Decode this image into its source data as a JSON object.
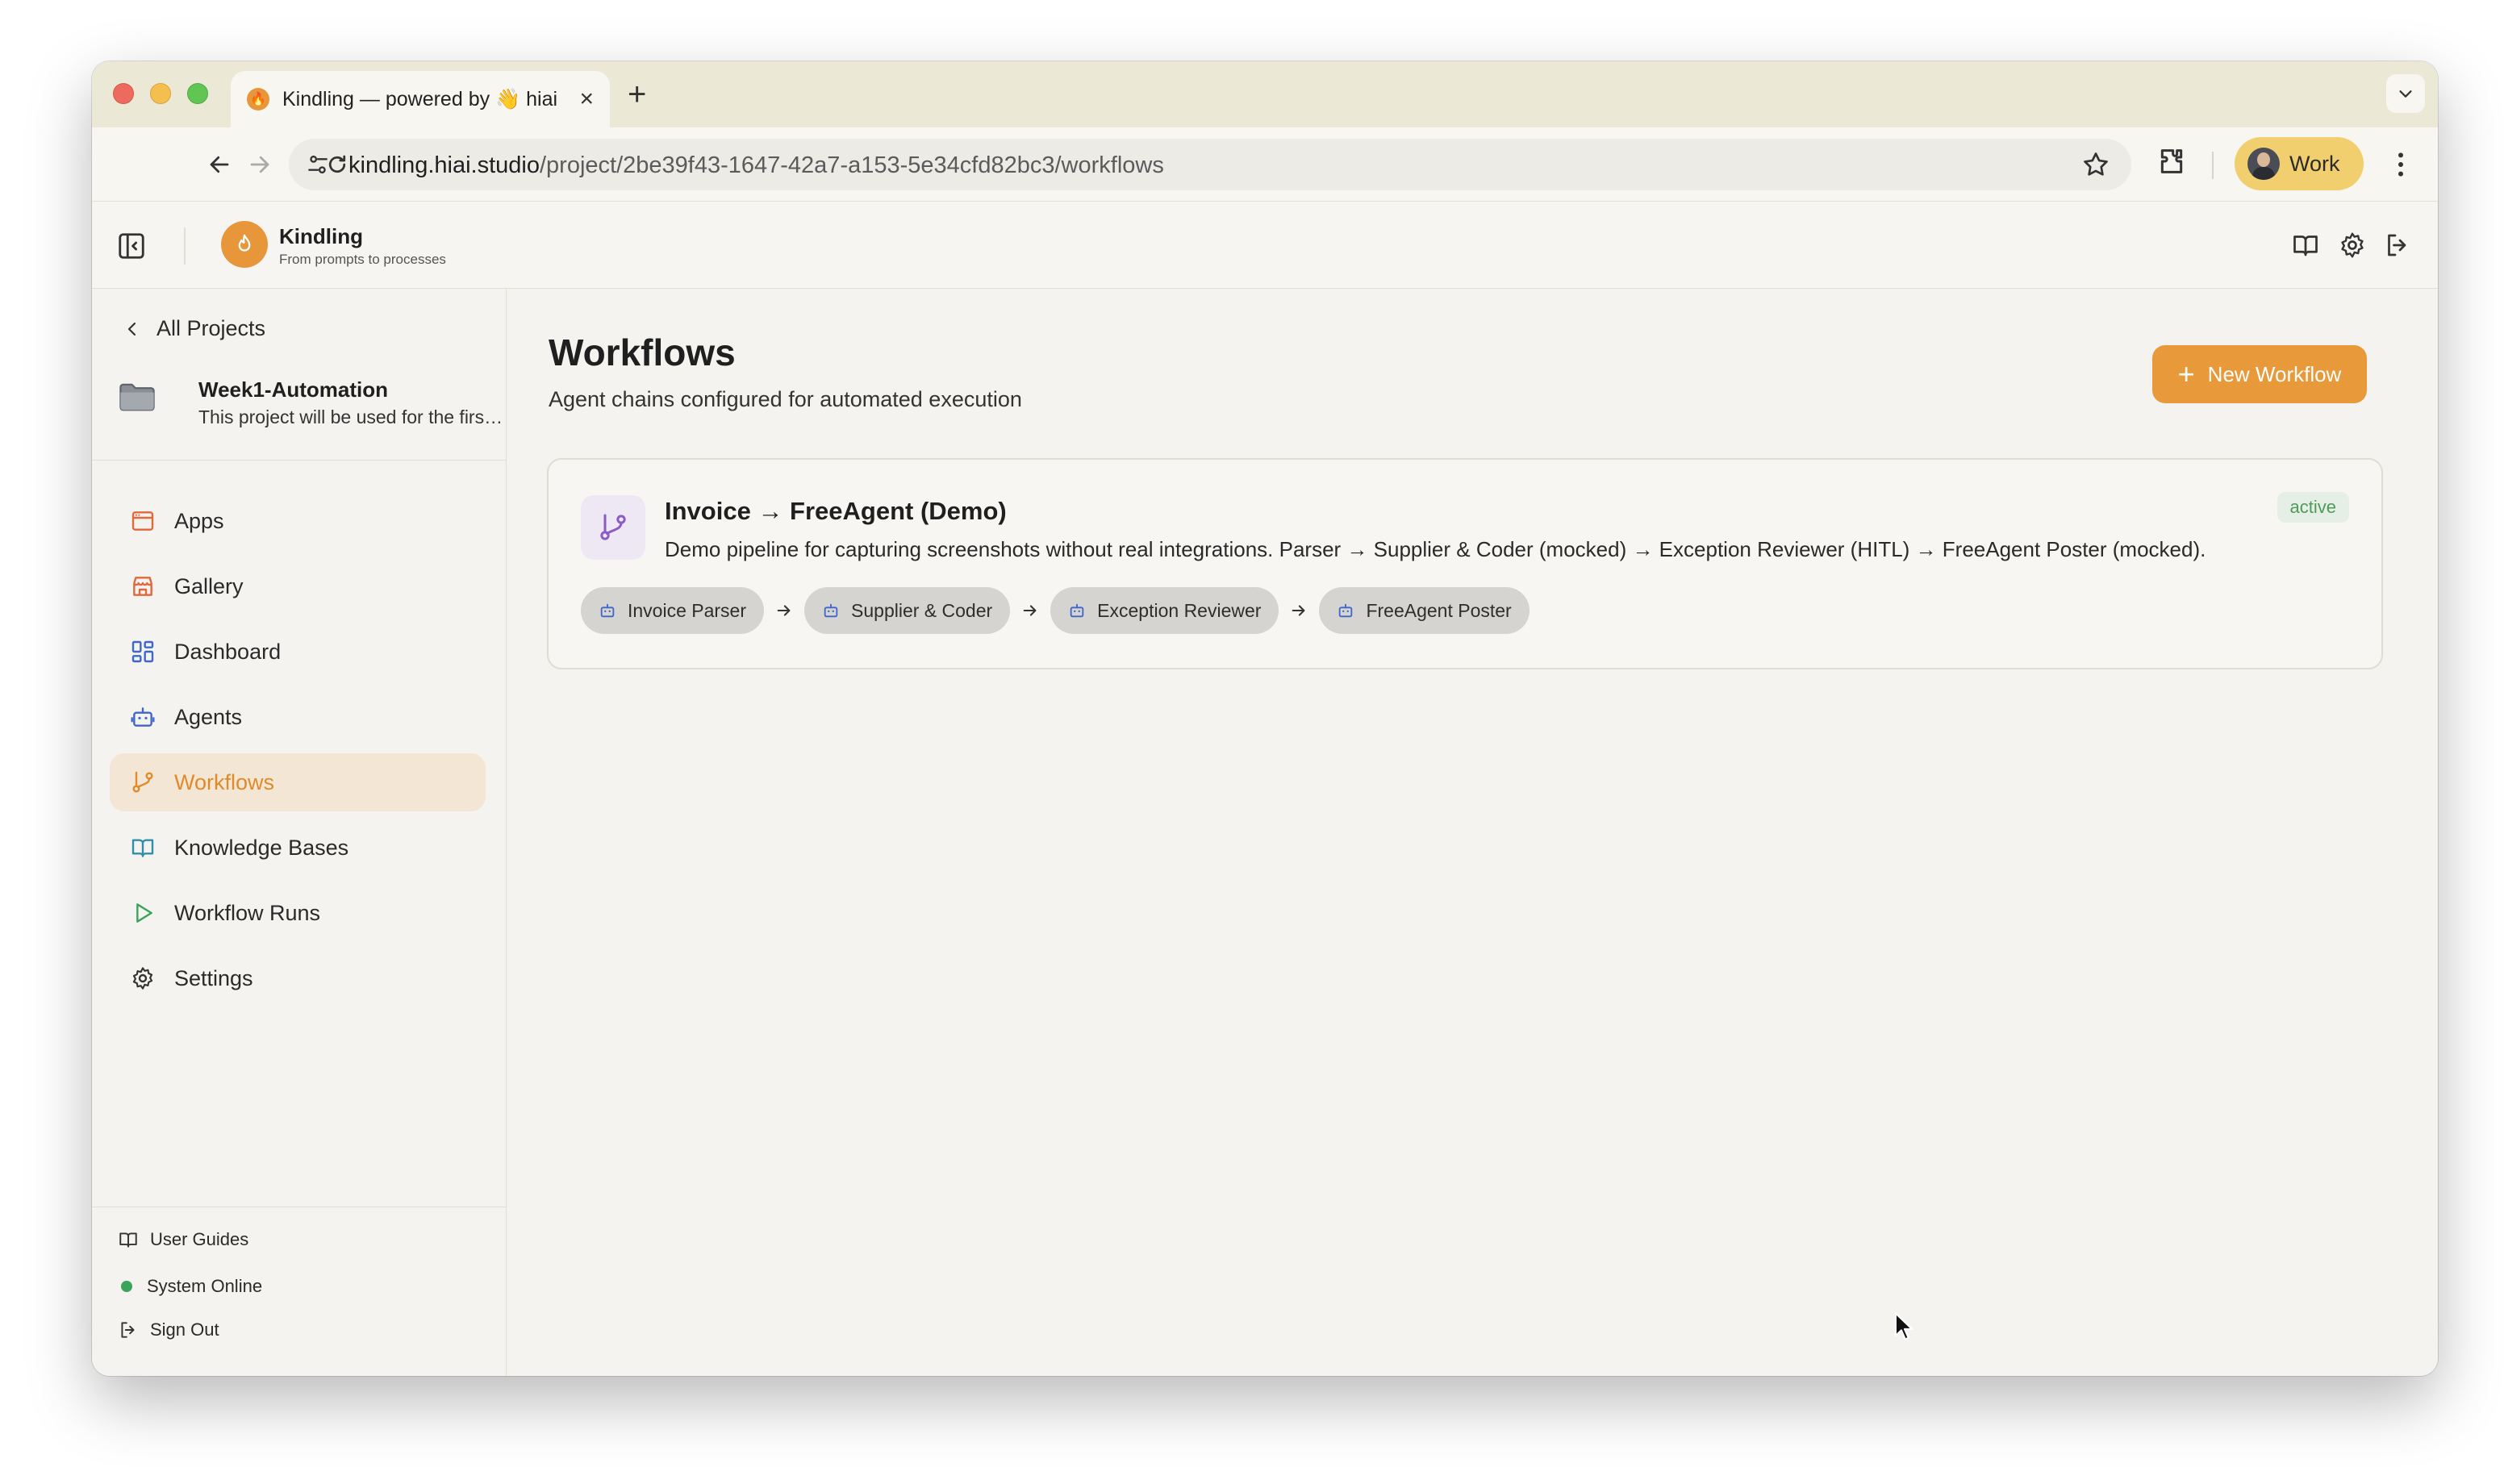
{
  "browser": {
    "tab_title": "Kindling — powered by 👋 hiai",
    "new_tab_label": "+",
    "url_host": "kindling.hiai.studio",
    "url_path": "/project/2be39f43-1647-42a7-a153-5e34cfd82bc3/workflows",
    "profile_label": "Work"
  },
  "header": {
    "brand_name": "Kindling",
    "brand_tagline": "From prompts to processes"
  },
  "sidebar": {
    "back_label": "All Projects",
    "project_name": "Week1-Automation",
    "project_description": "This project will be used for the first week of automation",
    "nav_items": [
      {
        "label": "Apps",
        "icon": "apps-icon",
        "color": "#e0683a"
      },
      {
        "label": "Gallery",
        "icon": "store-icon",
        "color": "#e0683a"
      },
      {
        "label": "Dashboard",
        "icon": "dashboard-icon",
        "color": "#3f66c9"
      },
      {
        "label": "Agents",
        "icon": "robot-icon",
        "color": "#3f66c9"
      },
      {
        "label": "Workflows",
        "icon": "workflow-icon",
        "color": "#e08a2a",
        "active": true
      },
      {
        "label": "Knowledge Bases",
        "icon": "book-icon",
        "color": "#2f8fa8"
      },
      {
        "label": "Workflow Runs",
        "icon": "play-icon",
        "color": "#3aa55a"
      },
      {
        "label": "Settings",
        "icon": "gear-icon",
        "color": "#333333"
      }
    ],
    "footer": {
      "guides_label": "User Guides",
      "status_label": "System Online",
      "signout_label": "Sign Out"
    }
  },
  "main": {
    "title": "Workflows",
    "subtitle": "Agent chains configured for automated execution",
    "new_button_label": "New Workflow",
    "workflows": [
      {
        "name": "Invoice → FreeAgent (Demo)",
        "description": "Demo pipeline for capturing screenshots without real integrations. Parser → Supplier & Coder (mocked) → Exception Reviewer (HITL) → FreeAgent Poster (mocked).",
        "status": "active",
        "chain": [
          "Invoice Parser",
          "Supplier & Coder",
          "Exception Reviewer",
          "FreeAgent Poster"
        ]
      }
    ]
  },
  "colors": {
    "accent": "#e8993a",
    "active_nav_bg": "#f4e6d4",
    "status_green": "#4f9a5a"
  }
}
